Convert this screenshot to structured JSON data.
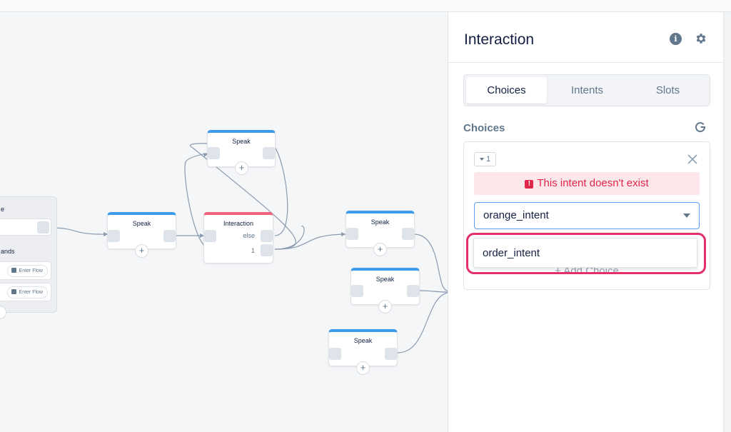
{
  "canvas": {
    "nodes": {
      "speak_top": "Speak",
      "speak_left": "Speak",
      "interaction": "Interaction",
      "speak_mid_right": "Speak",
      "speak_right_2": "Speak",
      "speak_bottom": "Speak"
    },
    "interaction_ports": {
      "else_label": "else",
      "choice_label": "1"
    },
    "block": {
      "label_top": "e",
      "label_commands": "ands",
      "row1_pill": "Enter Flow",
      "row2_pill": "Enter Flow"
    },
    "plus_symbol": "+"
  },
  "panel": {
    "title": "Interaction",
    "info_icon": "i",
    "tabs": [
      "Choices",
      "Intents",
      "Slots"
    ],
    "active_tab": "Choices",
    "section_title": "Choices",
    "choice": {
      "index": "1",
      "error_icon": "!",
      "error": "This intent doesn't exist",
      "selected_intent": "orange_intent",
      "add_choice_label": "+ Add Choice"
    },
    "dropdown_option": "order_intent"
  },
  "colors": {
    "accent_blue": "#3d9be9",
    "interaction_red": "#f2637a",
    "error_red": "#e0264a",
    "highlight_pink": "#e3306a"
  }
}
